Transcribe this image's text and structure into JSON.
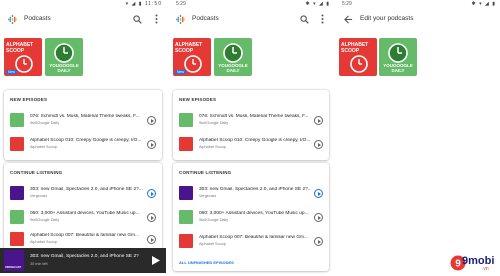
{
  "colors": {
    "accent": "#1a73e8",
    "scoop_red": "#e53935",
    "daily_green": "#66bb6a",
    "player_bg": "#2a2a2a"
  },
  "screen1": {
    "status_time": "",
    "status_time2": "11:50",
    "title": "Podcasts",
    "tiles": [
      {
        "name": "ALPHABET SCOOP",
        "badge": "New"
      },
      {
        "name": "YOUGOOGLE DAILY"
      }
    ],
    "new_episodes": {
      "header": "NEW EPISODES",
      "items": [
        {
          "title": "076: Schmidt vs. Musk, Material Theme tweaks, F...",
          "sub": "9to5Google Daily"
        },
        {
          "title": "Alphabet Scoop 010: Creepy Google is creepy, I/O...",
          "sub": "Alphabet Scoop"
        }
      ]
    },
    "continue": {
      "header": "CONTINUE LISTENING",
      "items": [
        {
          "title": "303: new Gmail, Spectacles 2.0, and iPhone SE 2?...",
          "sub": "Vergecast"
        },
        {
          "title": "060: 3,000+ Assistant devices, YouTube Music up...",
          "sub": "9to5Google Daily"
        },
        {
          "title": "Alphabet Scoop 007: Beautiful & familiar new Gm...",
          "sub": "Alphabet Scoop"
        }
      ]
    },
    "player": {
      "title": "303: new Gmail, Spectacles 2.0, and iPhone SE 2?",
      "sub": "30 min left",
      "thumb_label": "VERGECAST"
    }
  },
  "screen2": {
    "status_time": "5:29",
    "title": "Podcasts",
    "tiles": [
      {
        "name": "ALPHABET SCOOP",
        "badge": "New"
      },
      {
        "name": "YOUGOOGLE DAILY"
      }
    ],
    "new_episodes": {
      "header": "NEW EPISODES",
      "items": [
        {
          "title": "076: Schmidt vs. Musk, Material Theme tweaks, F...",
          "sub": "9to5Google Daily"
        },
        {
          "title": "Alphabet Scoop 010: Creepy Google is creepy, I/O...",
          "sub": "Alphabet Scoop"
        }
      ]
    },
    "continue": {
      "header": "CONTINUE LISTENING",
      "items": [
        {
          "title": "303: new Gmail, Spectacles 2.0, and iPhone SE 2?...",
          "sub": "Vergecast"
        },
        {
          "title": "060: 3,000+ Assistant devices, YouTube Music up...",
          "sub": "9to5Google Daily"
        },
        {
          "title": "Alphabet Scoop 007: Beautiful & familiar new Gm...",
          "sub": "Alphabet Scoop"
        }
      ],
      "link": "ALL UNFINISHED EPISODES"
    }
  },
  "screen3": {
    "status_time": "5:29",
    "title": "Edit your podcasts",
    "tiles": [
      {
        "name": "ALPHABET SCOOP"
      },
      {
        "name": "YOUGOOGLE DAILY"
      }
    ]
  },
  "watermark": {
    "text": "9mobi",
    "sub": ".vn"
  }
}
